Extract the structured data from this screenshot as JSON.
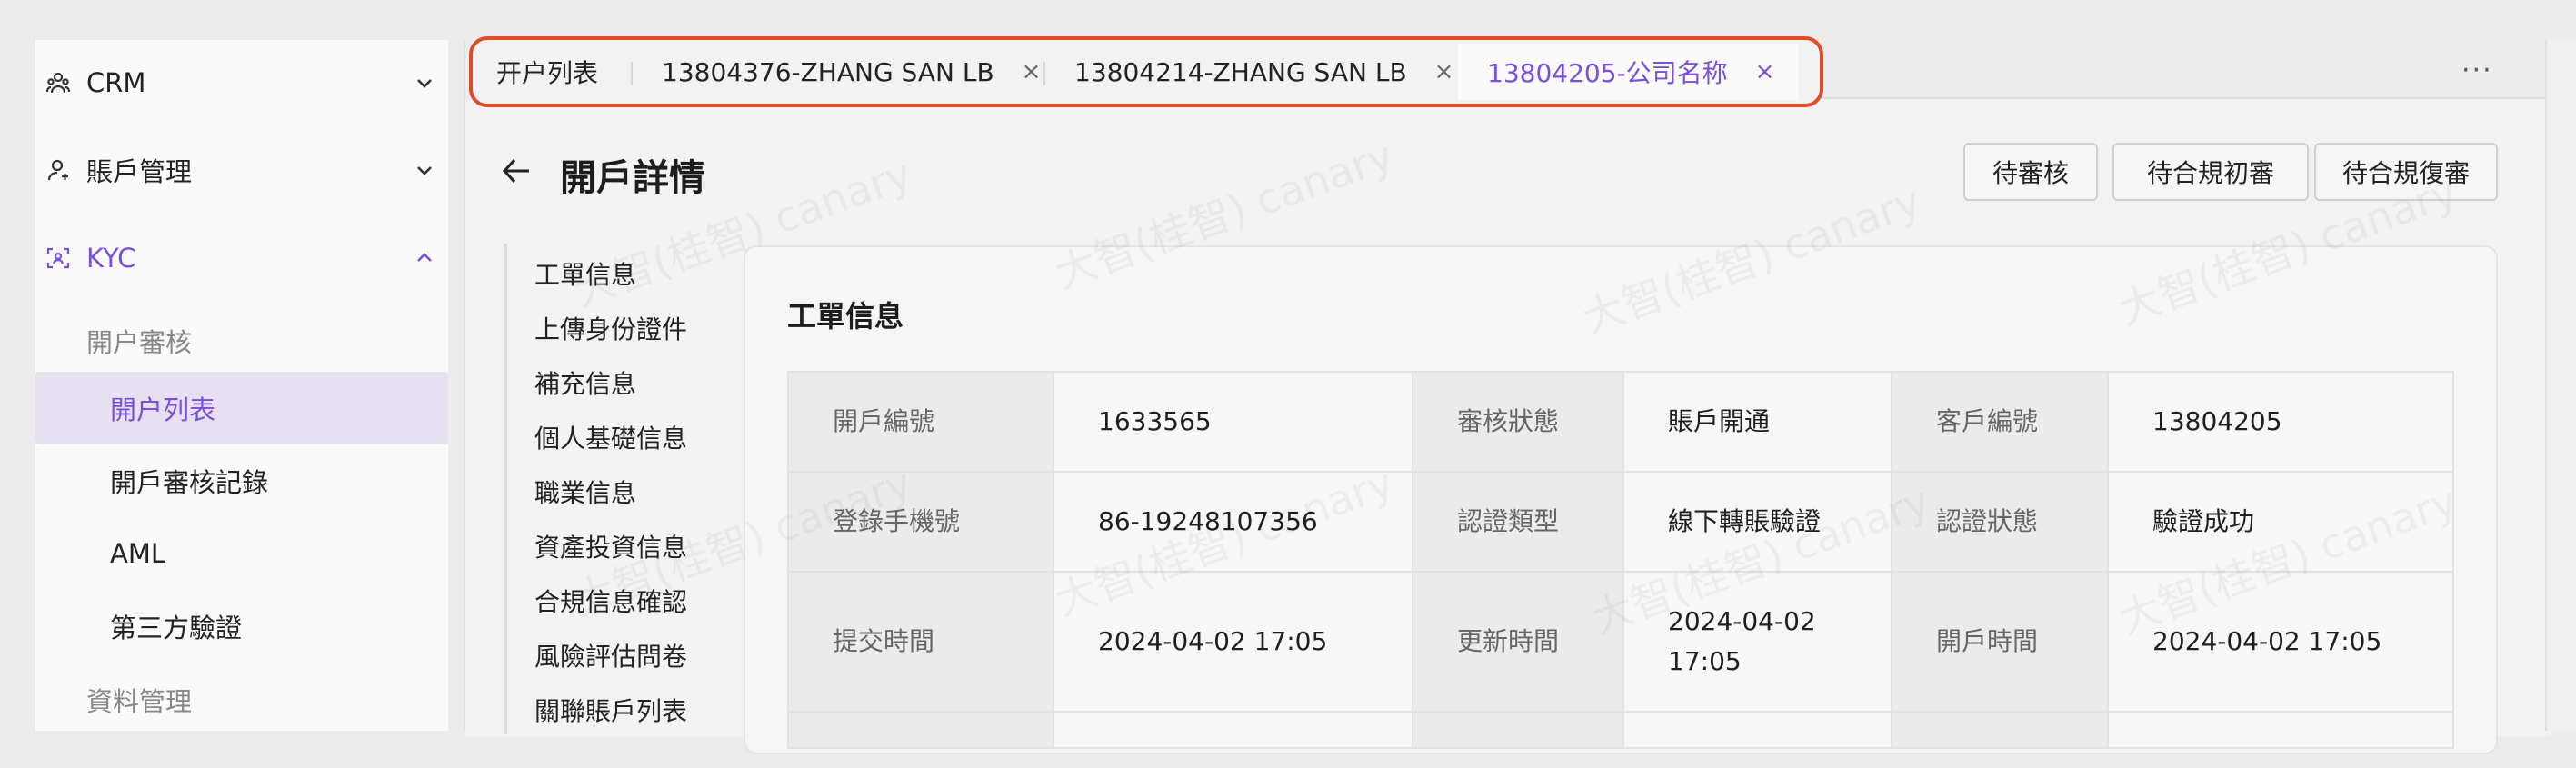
{
  "sidebar": {
    "groups": [
      {
        "label": "CRM",
        "icon": "users-icon",
        "expanded": false
      },
      {
        "label": "賬戶管理",
        "icon": "user-icon",
        "expanded": false
      },
      {
        "label": "KYC",
        "icon": "face-scan-icon",
        "expanded": true
      }
    ],
    "kyc_sections": [
      {
        "header": "開户審核",
        "items": [
          "開户列表",
          "開戶審核記錄",
          "AML",
          "第三方驗證"
        ]
      },
      {
        "header": "資料管理",
        "items": []
      }
    ],
    "selected_item": "開户列表"
  },
  "tabs": [
    {
      "label": "开户列表",
      "closable": false,
      "active": false
    },
    {
      "label": "13804376-ZHANG SAN LB",
      "closable": true,
      "active": false
    },
    {
      "label": "13804214-ZHANG SAN LB",
      "closable": true,
      "active": false
    },
    {
      "label": "13804205-公司名称",
      "closable": true,
      "active": true
    }
  ],
  "tab_close_glyph": "×",
  "more_glyph": "···",
  "page": {
    "title": "開戶詳情",
    "actions": [
      "待審核",
      "待合規初審",
      "待合規復審"
    ]
  },
  "anchors": [
    "工單信息",
    "上傳身份證件",
    "補充信息",
    "個人基礎信息",
    "職業信息",
    "資產投資信息",
    "合規信息確認",
    "風險評估問卷",
    "關聯賬戶列表"
  ],
  "work_order": {
    "title": "工單信息",
    "rows": [
      [
        {
          "label": "開戶編號",
          "value": "1633565"
        },
        {
          "label": "審核狀態",
          "value": "賬戶開通"
        },
        {
          "label": "客戶編號",
          "value": "13804205"
        }
      ],
      [
        {
          "label": "登錄手機號",
          "value": "86-19248107356"
        },
        {
          "label": "認證類型",
          "value": "線下轉賬驗證"
        },
        {
          "label": "認證狀態",
          "value": "驗證成功"
        }
      ],
      [
        {
          "label": "提交時間",
          "value": "2024-04-02 17:05"
        },
        {
          "label": "更新時間",
          "value": "2024-04-02 17:05"
        },
        {
          "label": "開戶時間",
          "value": "2024-04-02 17:05"
        }
      ]
    ]
  },
  "watermark_text": "大智(桂智) canary",
  "colors": {
    "accent": "#7a4fdb",
    "highlight_border": "#e24a2a",
    "selected_bg": "#e6e0f0"
  }
}
